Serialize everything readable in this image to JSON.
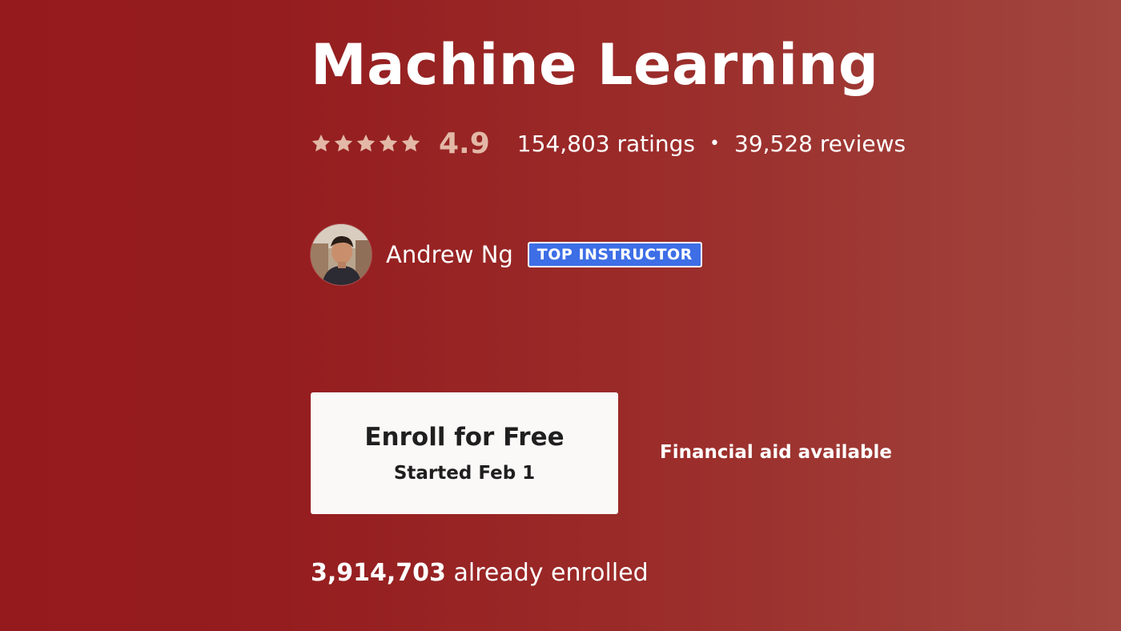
{
  "course": {
    "title": "Machine Learning"
  },
  "rating": {
    "stars_total": 5,
    "stars_filled": 5,
    "value": "4.9",
    "ratings_text": "154,803 ratings",
    "separator": "•",
    "reviews_text": "39,528 reviews",
    "star_color": "#e3b8a7"
  },
  "instructor": {
    "name": "Andrew Ng",
    "badge": "TOP INSTRUCTOR",
    "badge_color": "#3d6ee6"
  },
  "enroll": {
    "label": "Enroll for Free",
    "sublabel": "Started Feb 1"
  },
  "financial_aid": {
    "label": "Financial aid available"
  },
  "enrolled": {
    "count": "3,914,703",
    "suffix": "already enrolled"
  },
  "colors": {
    "background_start": "#951a1d",
    "background_end": "#a2463f",
    "button_bg": "#fbf8f8",
    "button_text": "#1f1f1f"
  }
}
